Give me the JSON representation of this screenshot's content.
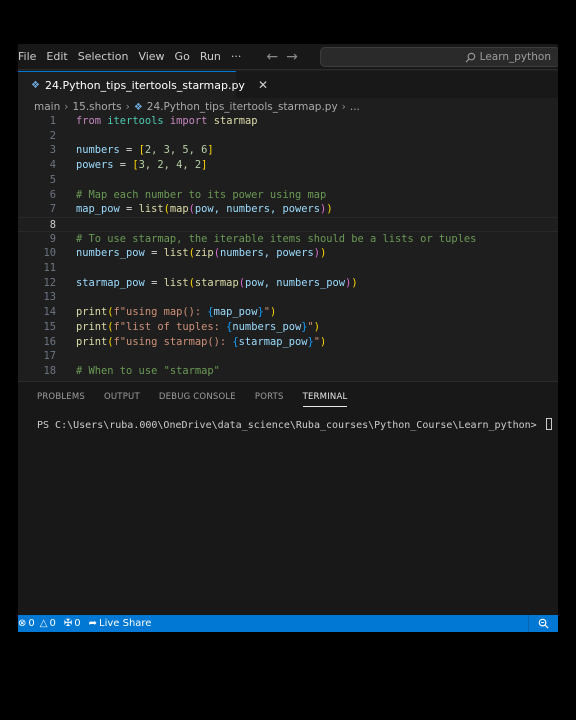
{
  "menu": [
    "File",
    "Edit",
    "Selection",
    "View",
    "Go",
    "Run",
    "···"
  ],
  "nav": {
    "back": "←",
    "forward": "→"
  },
  "search": {
    "text": "Learn_python"
  },
  "tab": {
    "label": "24.Python_tips_itertools_starmap.py"
  },
  "breadcrumb": {
    "b1": "main",
    "b2": "15.shorts",
    "b3": "24.Python_tips_itertools_starmap.py",
    "b4": "..."
  },
  "code_lines": [
    {
      "n": "1"
    },
    {
      "n": "2"
    },
    {
      "n": "3"
    },
    {
      "n": "4"
    },
    {
      "n": "5"
    },
    {
      "n": "6"
    },
    {
      "n": "7"
    },
    {
      "n": "8"
    },
    {
      "n": "9"
    },
    {
      "n": "10"
    },
    {
      "n": "11"
    },
    {
      "n": "12"
    },
    {
      "n": "13"
    },
    {
      "n": "14"
    },
    {
      "n": "15"
    },
    {
      "n": "16"
    },
    {
      "n": "17"
    },
    {
      "n": "18"
    }
  ],
  "code": {
    "l1": {
      "kw1": "from",
      "mod": "itertools",
      "kw2": "import",
      "name": "starmap"
    },
    "l3": {
      "var": "numbers",
      "eq": " = ",
      "open": "[",
      "vals": "2, 3, 5, 6",
      "close": "]"
    },
    "l4": {
      "var": "powers",
      "eq": " = ",
      "open": "[",
      "vals": "3, 2, 4, 2",
      "close": "]"
    },
    "l6": {
      "comment": "# Map each number to its power using map"
    },
    "l7": {
      "var": "map_pow",
      "eq": " = ",
      "f1": "list",
      "p1": "(",
      "f2": "map",
      "p2": "(",
      "args": "pow, numbers, powers",
      "c2": ")",
      "c1": ")"
    },
    "l9": {
      "comment": "# To use starmap, the iterable items should be a lists or tuples"
    },
    "l10": {
      "var": "numbers_pow",
      "eq": " = ",
      "f1": "list",
      "p1": "(",
      "f2": "zip",
      "p2": "(",
      "args": "numbers, powers",
      "c2": ")",
      "c1": ")"
    },
    "l12": {
      "var": "starmap_pow",
      "eq": " = ",
      "f1": "list",
      "p1": "(",
      "f2": "starmap",
      "p2": "(",
      "args": "pow, numbers_pow",
      "c2": ")",
      "c1": ")"
    },
    "l14": {
      "fn": "print",
      "p": "(",
      "pre": "f\"using map(): ",
      "ob": "{",
      "var": "map_pow",
      "cb": "}",
      "post": "\"",
      "c": ")"
    },
    "l15": {
      "fn": "print",
      "p": "(",
      "pre": "f\"list of tuples: ",
      "ob": "{",
      "var": "numbers_pow",
      "cb": "}",
      "post": "\"",
      "c": ")"
    },
    "l16": {
      "fn": "print",
      "p": "(",
      "pre": "f\"using starmap(): ",
      "ob": "{",
      "var": "starmap_pow",
      "cb": "}",
      "post": "\"",
      "c": ")"
    },
    "l18": {
      "comment": "# When to use \"starmap\""
    }
  },
  "panel": {
    "tabs": [
      "PROBLEMS",
      "OUTPUT",
      "DEBUG CONSOLE",
      "PORTS",
      "TERMINAL"
    ]
  },
  "terminal": {
    "prompt": "PS C:\\Users\\ruba.000\\OneDrive\\data_science\\Ruba_courses\\Python_Course\\Learn_python> "
  },
  "status": {
    "errors": "0",
    "warnings": "0",
    "ports": "0",
    "live_share": "Live Share"
  },
  "colors": {
    "statusbar": "#0078d4",
    "editor_bg": "#1e1e1e",
    "keyword": "#c586c0",
    "comment": "#6a9955",
    "string": "#ce9178"
  },
  "icons": [
    "python-file-icon",
    "close-icon",
    "search-icon",
    "error-icon",
    "warning-icon",
    "port-icon",
    "live-share-icon",
    "zoom-icon"
  ]
}
